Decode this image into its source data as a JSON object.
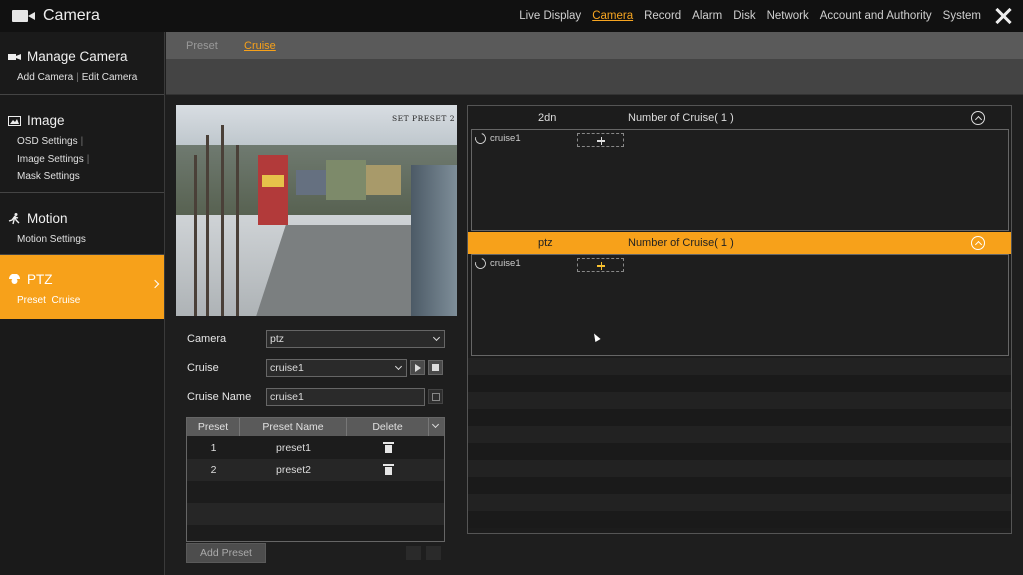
{
  "app": {
    "title": "Camera"
  },
  "topnav": [
    {
      "label": "Live Display",
      "active": false
    },
    {
      "label": "Camera",
      "active": true
    },
    {
      "label": "Record",
      "active": false
    },
    {
      "label": "Alarm",
      "active": false
    },
    {
      "label": "Disk",
      "active": false
    },
    {
      "label": "Network",
      "active": false
    },
    {
      "label": "Account and Authority",
      "active": false
    },
    {
      "label": "System",
      "active": false
    }
  ],
  "sidebar": {
    "groups": [
      {
        "label": "Manage Camera",
        "icon": "camera-icon",
        "items": [
          "Add Camera",
          "Edit Camera"
        ]
      },
      {
        "label": "Image",
        "icon": "image-icon",
        "items": [
          "OSD Settings",
          "Image Settings",
          "Mask Settings"
        ]
      },
      {
        "label": "Motion",
        "icon": "motion-icon",
        "items": [
          "Motion Settings"
        ]
      },
      {
        "label": "PTZ",
        "icon": "ptz-icon",
        "items": [
          "Preset",
          "Cruise"
        ],
        "active": true
      }
    ]
  },
  "subtabs": {
    "preset": "Preset",
    "cruise": "Cruise",
    "active": "Cruise"
  },
  "preview": {
    "osd_text": "SET PRESET 2"
  },
  "form": {
    "camera_label": "Camera",
    "camera_value": "ptz",
    "cruise_label": "Cruise",
    "cruise_value": "cruise1",
    "cruise_name_label": "Cruise Name",
    "cruise_name_value": "cruise1"
  },
  "preset_table": {
    "headers": {
      "preset": "Preset",
      "name": "Preset Name",
      "delete": "Delete"
    },
    "rows": [
      {
        "preset": "1",
        "name": "preset1"
      },
      {
        "preset": "2",
        "name": "preset2"
      }
    ]
  },
  "add_preset_label": "Add Preset",
  "cruise_panel": {
    "groups": [
      {
        "name": "2dn",
        "count_label": "Number of Cruise( 1 )",
        "cruise": "cruise1"
      },
      {
        "name": "ptz",
        "count_label": "Number of Cruise( 1 )",
        "cruise": "cruise1",
        "active": true
      }
    ]
  },
  "colors": {
    "accent": "#f7a11a",
    "background": "#1e1e1e",
    "topbar": "#111111"
  }
}
